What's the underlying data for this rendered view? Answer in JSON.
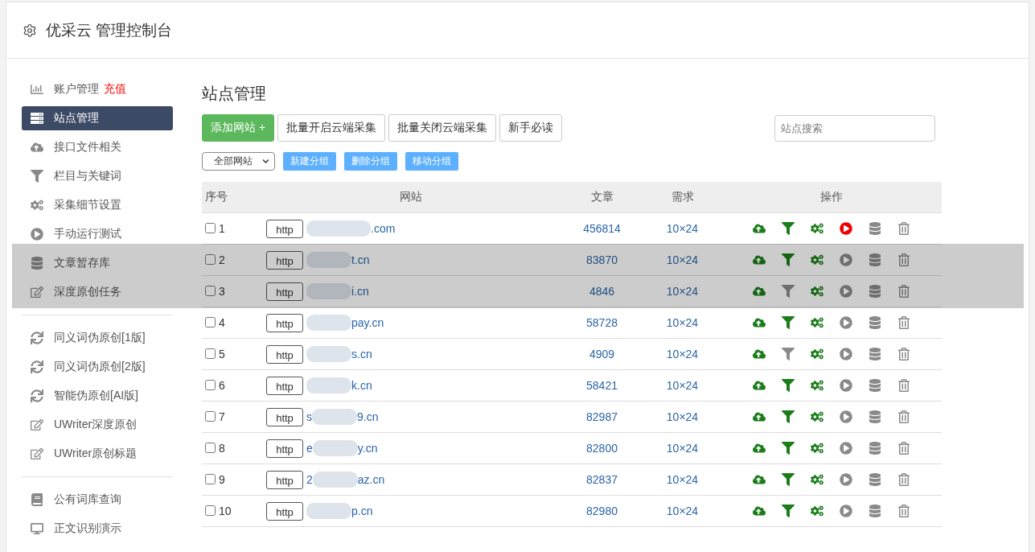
{
  "header": {
    "title": "优采云 管理控制台"
  },
  "sidebar": {
    "groups": [
      {
        "items": [
          {
            "label": "账户管理",
            "badge": "充值",
            "selected": false
          },
          {
            "label": "站点管理",
            "selected": true
          },
          {
            "label": "接口文件相关",
            "selected": false
          },
          {
            "label": "栏目与关键词",
            "selected": false
          },
          {
            "label": "采集细节设置",
            "selected": false
          },
          {
            "label": "手动运行测试",
            "selected": false
          },
          {
            "label": "文章暂存库",
            "selected": false
          },
          {
            "label": "深度原创任务",
            "selected": false
          }
        ]
      },
      {
        "items": [
          {
            "label": "同义词伪原创[1版]",
            "selected": false
          },
          {
            "label": "同义词伪原创[2版]",
            "selected": false
          },
          {
            "label": "智能伪原创[AI版]",
            "selected": false
          },
          {
            "label": "UWriter深度原创",
            "selected": false
          },
          {
            "label": "UWriter原创标题",
            "selected": false
          }
        ]
      },
      {
        "items": [
          {
            "label": "公有词库查询",
            "selected": false
          },
          {
            "label": "正文识别演示",
            "selected": false
          }
        ]
      }
    ]
  },
  "page": {
    "title": "站点管理"
  },
  "toolbar": {
    "buttons": [
      {
        "label": "添加网站 +",
        "kind": "primary"
      },
      {
        "label": "批量开启云端采集",
        "kind": "default"
      },
      {
        "label": "批量关闭云端采集",
        "kind": "default"
      },
      {
        "label": "新手必读",
        "kind": "default"
      }
    ],
    "search": {
      "placeholder": "站点搜索"
    }
  },
  "group_bar": {
    "select": {
      "value": "全部网站"
    },
    "buttons": [
      "新建分组",
      "删除分组",
      "移动分组"
    ]
  },
  "table": {
    "columns": [
      "序号",
      "网站",
      "文章",
      "需求",
      "操作"
    ],
    "rows": [
      {
        "checked": false,
        "number": "1",
        "protocol": "http",
        "url_end": ".com",
        "articles": "456814",
        "demand": "10×24",
        "filter_on": true,
        "running": true
      },
      {
        "checked": false,
        "number": "2",
        "protocol": "http",
        "url_end": "t.cn",
        "articles": "83870",
        "demand": "10×24",
        "filter_on": true,
        "running": false
      },
      {
        "checked": false,
        "number": "3",
        "protocol": "http",
        "url_end": "i.cn",
        "articles": "4846",
        "demand": "10×24",
        "filter_on": false,
        "running": false
      },
      {
        "checked": false,
        "number": "4",
        "protocol": "http",
        "url_end": "pay.cn",
        "articles": "58728",
        "demand": "10×24",
        "filter_on": true,
        "running": false
      },
      {
        "checked": false,
        "number": "5",
        "protocol": "http",
        "url_end": "s.cn",
        "articles": "4909",
        "demand": "10×24",
        "filter_on": false,
        "running": false
      },
      {
        "checked": false,
        "number": "6",
        "protocol": "http",
        "url_end": "k.cn",
        "articles": "58421",
        "demand": "10×24",
        "filter_on": true,
        "running": false
      },
      {
        "checked": false,
        "number": "7",
        "protocol": "http",
        "url_start": "s",
        "url_end": "9.cn",
        "articles": "82987",
        "demand": "10×24",
        "filter_on": true,
        "running": false
      },
      {
        "checked": false,
        "number": "8",
        "protocol": "http",
        "url_start": "e",
        "url_end": "y.cn",
        "articles": "82800",
        "demand": "10×24",
        "filter_on": true,
        "running": false
      },
      {
        "checked": false,
        "number": "9",
        "protocol": "http",
        "url_start": "2",
        "url_end": "az.cn",
        "articles": "82837",
        "demand": "10×24",
        "filter_on": true,
        "running": false
      },
      {
        "checked": false,
        "number": "10",
        "protocol": "http",
        "url_end": "p.cn",
        "articles": "82980",
        "demand": "10×24",
        "filter_on": true,
        "running": false
      }
    ]
  },
  "highlight_band": true
}
